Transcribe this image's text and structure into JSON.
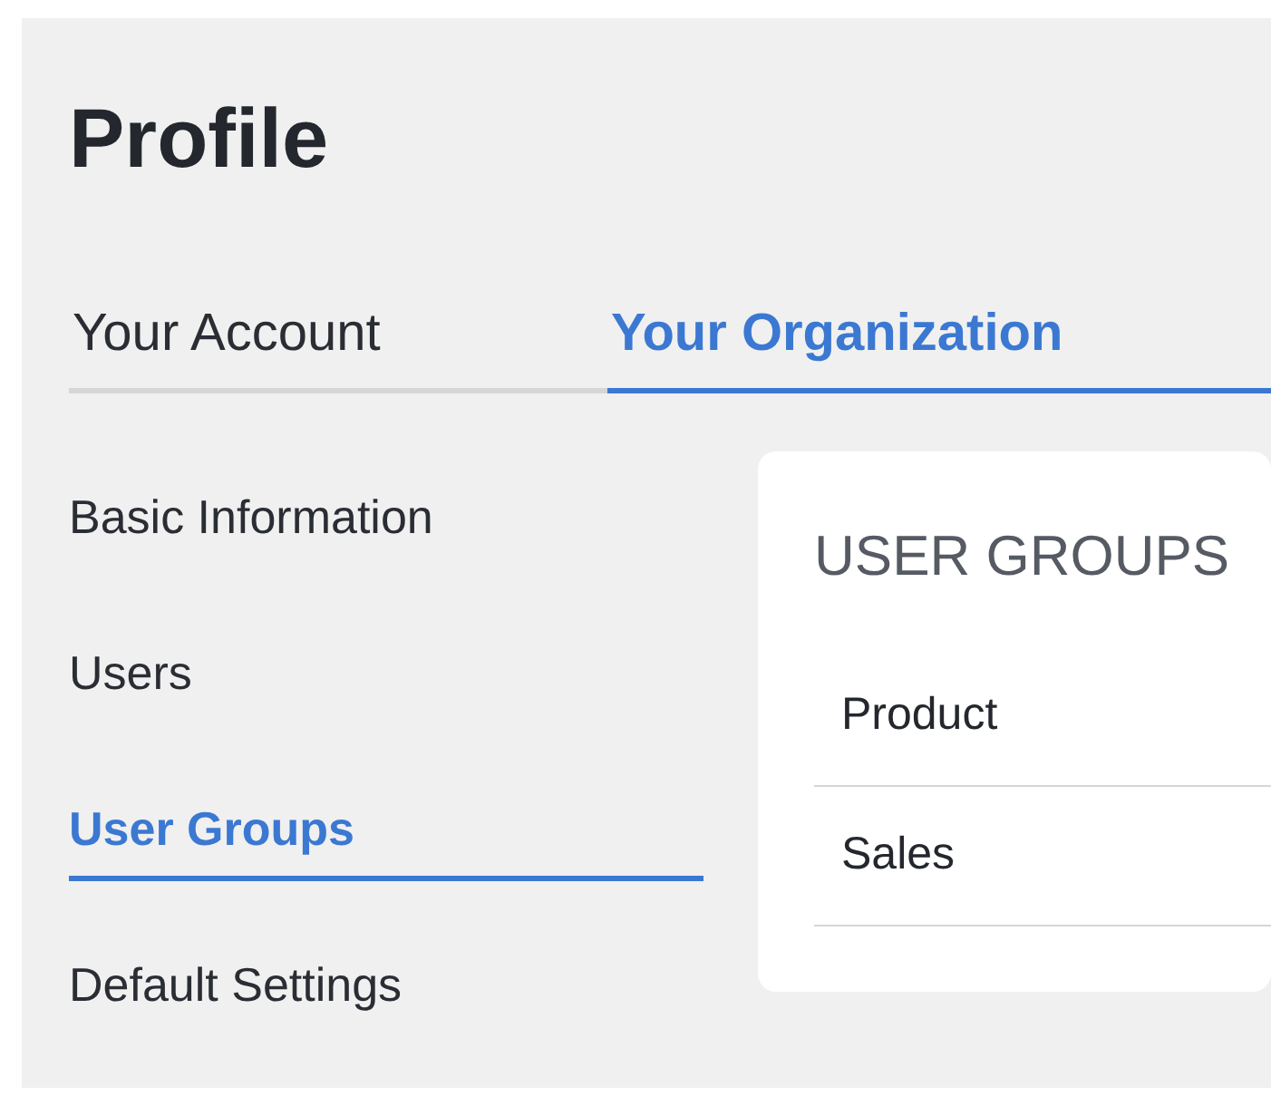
{
  "page": {
    "title": "Profile"
  },
  "tabs": [
    {
      "label": "Your Account",
      "selected": false
    },
    {
      "label": "Your Organization",
      "selected": true
    }
  ],
  "sidebar": {
    "items": [
      {
        "label": "Basic Information",
        "selected": false
      },
      {
        "label": "Users",
        "selected": false
      },
      {
        "label": "User Groups",
        "selected": true
      },
      {
        "label": "Default Settings",
        "selected": false
      }
    ]
  },
  "card": {
    "title": "USER GROUPS",
    "rows": [
      {
        "label": "Product"
      },
      {
        "label": "Sales"
      }
    ]
  }
}
